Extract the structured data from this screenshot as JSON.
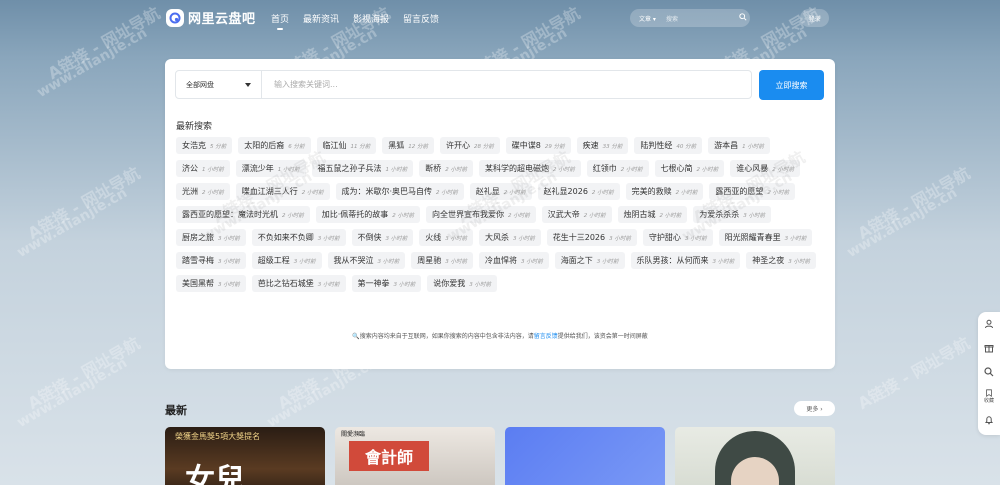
{
  "site": {
    "logo_text": "网里云盘吧"
  },
  "nav": [
    {
      "label": "首页",
      "active": true
    },
    {
      "label": "最新资讯",
      "active": false
    },
    {
      "label": "影视海报",
      "active": false
    },
    {
      "label": "留言反馈",
      "active": false
    }
  ],
  "header_search": {
    "type_label": "文章",
    "placeholder": "搜索",
    "icon": "search-icon"
  },
  "login_label": "登录",
  "search": {
    "select_label": "全部网盘",
    "placeholder": "输入搜索关键词...",
    "button_label": "立即搜索"
  },
  "recent": {
    "title": "最新搜索",
    "items": [
      {
        "label": "女浩克",
        "time": "5 分前"
      },
      {
        "label": "太阳的后裔",
        "time": "6 分前"
      },
      {
        "label": "临江仙",
        "time": "11 分前"
      },
      {
        "label": "黑狐",
        "time": "12 分前"
      },
      {
        "label": "许开心",
        "time": "28 分前"
      },
      {
        "label": "碟中谍8",
        "time": "29 分前"
      },
      {
        "label": "疾速",
        "time": "33 分前"
      },
      {
        "label": "陆判性经",
        "time": "40 分前"
      },
      {
        "label": "游本昌",
        "time": "1 小时前"
      },
      {
        "label": "济公",
        "time": "1 小时前"
      },
      {
        "label": "漂流少年",
        "time": "1 小时前"
      },
      {
        "label": "福五鼠之孙子兵法",
        "time": "1 小时前"
      },
      {
        "label": "断桥",
        "time": "2 小时前"
      },
      {
        "label": "某科学的超电磁炮",
        "time": "2 小时前"
      },
      {
        "label": "红领巾",
        "time": "2 小时前"
      },
      {
        "label": "七根心简",
        "time": "2 小时前"
      },
      {
        "label": "谁心风暴",
        "time": "2 小时前"
      },
      {
        "label": "光洲",
        "time": "2 小时前"
      },
      {
        "label": "喋血江湖三人行",
        "time": "2 小时前"
      },
      {
        "label": "成为：米歇尔·奥巴马自传",
        "time": "2 小时前"
      },
      {
        "label": "赵礼显",
        "time": "2 小时前"
      },
      {
        "label": "赵礼显2026",
        "time": "2 小时前"
      },
      {
        "label": "完美的救赎",
        "time": "2 小时前"
      },
      {
        "label": "露西亚的愿望",
        "time": "2 小时前"
      },
      {
        "label": "露西亚的愿望：魔法时光机",
        "time": "2 小时前"
      },
      {
        "label": "加比·佩蒂托的故事",
        "time": "2 小时前"
      },
      {
        "label": "向全世界宣布我爱你",
        "time": "2 小时前"
      },
      {
        "label": "汉武大帝",
        "time": "2 小时前"
      },
      {
        "label": "烛阴古城",
        "time": "2 小时前"
      },
      {
        "label": "为爱杀杀杀",
        "time": "3 小时前"
      },
      {
        "label": "厨房之旅",
        "time": "3 小时前"
      },
      {
        "label": "不负如来不负卿",
        "time": "3 小时前"
      },
      {
        "label": "不倒侠",
        "time": "3 小时前"
      },
      {
        "label": "火线",
        "time": "3 小时前"
      },
      {
        "label": "大风杀",
        "time": "3 小时前"
      },
      {
        "label": "花生十三2026",
        "time": "3 小时前"
      },
      {
        "label": "守护甜心",
        "time": "3 小时前"
      },
      {
        "label": "阳光照耀青春里",
        "time": "3 小时前"
      },
      {
        "label": "踏雪寻梅",
        "time": "3 小时前"
      },
      {
        "label": "超级工程",
        "time": "3 小时前"
      },
      {
        "label": "我从不哭泣",
        "time": "3 小时前"
      },
      {
        "label": "周星驰",
        "time": "3 小时前"
      },
      {
        "label": "冷血悍将",
        "time": "3 小时前"
      },
      {
        "label": "海面之下",
        "time": "3 小时前"
      },
      {
        "label": "乐队男孩：从何而来",
        "time": "3 小时前"
      },
      {
        "label": "神圣之夜",
        "time": "3 小时前"
      },
      {
        "label": "美国黑帮",
        "time": "3 小时前"
      },
      {
        "label": "芭比之钻石城堡",
        "time": "3 小时前"
      },
      {
        "label": "第一神拳",
        "time": "3 小时前"
      },
      {
        "label": "说你爱我",
        "time": "3 小时前"
      }
    ]
  },
  "notice": {
    "prefix": "搜索内容均来自于互联网，如果你搜索的内容中包含非法内容，请",
    "link": "留言反馈",
    "suffix": "提供给我们，该资会第一时间屏蔽"
  },
  "latest": {
    "title": "最新",
    "more_label": "更多 ›",
    "posters": [
      {
        "caption": "榮獲金馬獎5項大獎提名",
        "big": "女兒"
      },
      {
        "caption": "關愛瀕臨",
        "big": "會計師"
      },
      {
        "caption": "",
        "big": ""
      },
      {
        "caption": "",
        "big": ""
      }
    ]
  },
  "watermark_text": "A链接 - 网址导航",
  "watermark_url": "www.alianjie.cn",
  "side_tools": [
    "user-icon",
    "gift-icon",
    "search-icon",
    "bookmark-icon",
    "bell-icon"
  ],
  "side_tools_label": "收藏"
}
